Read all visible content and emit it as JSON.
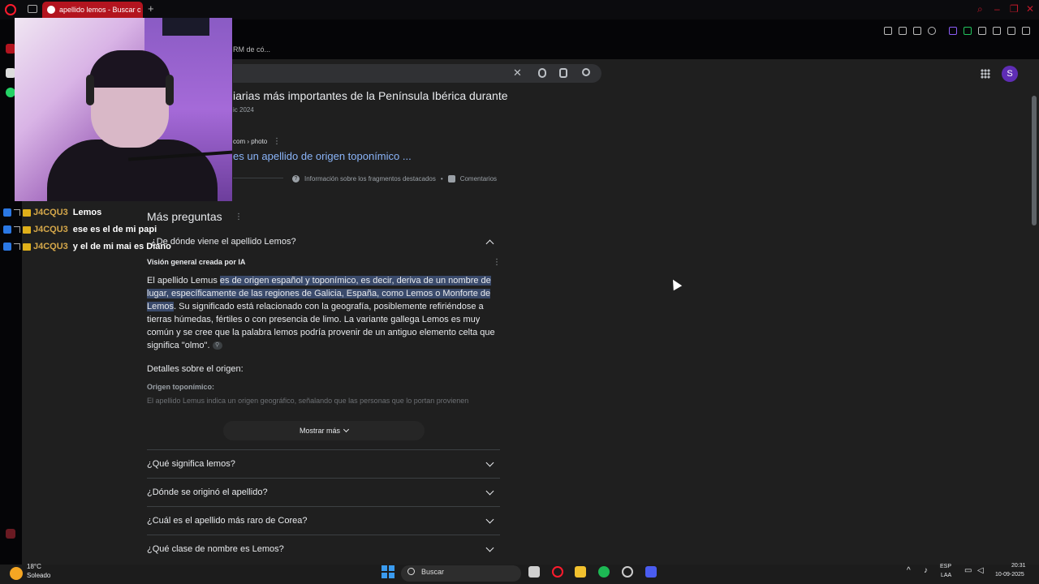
{
  "browser": {
    "tab_title": "apellido lemos - Buscar c",
    "new_tab": "+",
    "bookmark": "RM de có..."
  },
  "google": {
    "avatar_letter": "S",
    "result_title": "iarias más importantes de la Península Ibérica durante",
    "result_date": "ic 2024",
    "source": "com › photo",
    "source_link": "es un apellido de origen toponímico ...",
    "snippet_info": "Información sobre los fragmentos destacados",
    "comments": "Comentarios",
    "paa_title": "Más preguntas",
    "open_question": "¿De dónde viene el apellido Lemos?",
    "overview_label": "Visión general creada por IA",
    "para_intro": "El apellido Lemus ",
    "para_hl": "es de origen español y toponímico, es decir, deriva de un nombre de lugar, específicamente de las regiones de Galicia, España, como Lemos o Monforte de Lemos",
    "para_rest": ". Su significado está relacionado con la geografía, posiblemente refiriéndose a tierras húmedas, fértiles o con presencia de limo. La variante gallega Lemos es muy común y se cree que la palabra lemos podría provenir de un antiguo elemento celta que significa \"olmo\".",
    "details_title": "Detalles sobre el origen:",
    "origin_title": "Origen toponímico:",
    "origin_text": "El apellido Lemus indica un origen geográfico, señalando que las personas que lo portan provienen",
    "show_more": "Mostrar más",
    "questions": [
      "¿Qué significa lemos?",
      "¿Dónde se originó el apellido?",
      "¿Cuál es el apellido más raro de Corea?",
      "¿Qué clase de nombre es Lemos?"
    ]
  },
  "chat": [
    {
      "user": "J4CQU3",
      "msg": "Lemos"
    },
    {
      "user": "J4CQU3",
      "msg": "ese es el de mi papi"
    },
    {
      "user": "J4CQU3",
      "msg": "y el de mi mai es Diano"
    }
  ],
  "taskbar": {
    "temp": "18°C",
    "weather": "Soleado",
    "search": "Buscar",
    "lang1": "ESP",
    "lang2": "LAA",
    "time": "20:31",
    "date": "10-09-2025"
  },
  "colors": {
    "accent": "#ff1b2d",
    "link": "#8ab4f8",
    "highlight": "#3a4a6b",
    "page_bg": "#1f1f1f"
  }
}
